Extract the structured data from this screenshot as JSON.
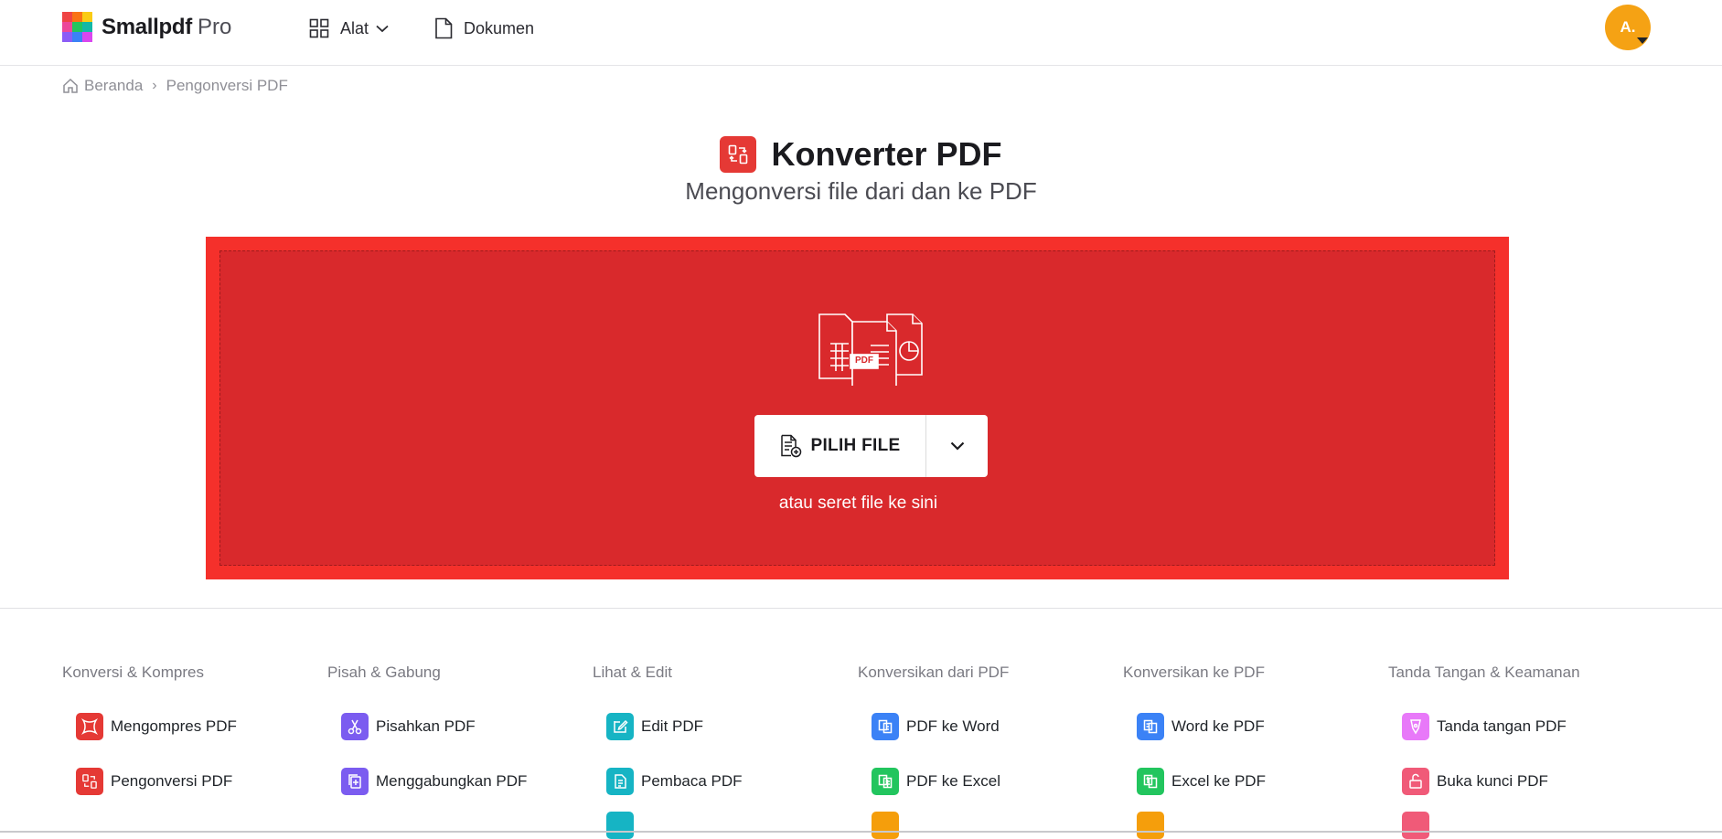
{
  "header": {
    "brand": "Smallpdf",
    "brand_suffix": "Pro",
    "nav_tools": "Alat",
    "nav_docs": "Dokumen",
    "avatar_initials": "A."
  },
  "breadcrumb": {
    "home": "Beranda",
    "separator": "›",
    "current": "Pengonversi PDF"
  },
  "hero": {
    "title": "Konverter PDF",
    "subtitle": "Mengonversi file dari dan ke PDF",
    "illustration_badge": "PDF",
    "choose_button": "PILIH FILE",
    "drop_hint": "atau seret file ke sini"
  },
  "colors": {
    "brand_red": "#e53935",
    "dropzone_outer": "#f5302b",
    "dropzone_inner": "#d9292c",
    "avatar": "#f5a214"
  },
  "tool_columns": [
    {
      "title": "Konversi & Kompres",
      "items": [
        {
          "label": "Mengompres PDF",
          "icon": "compress-icon",
          "color": "#e53935"
        },
        {
          "label": "Pengonversi PDF",
          "icon": "convert-icon",
          "color": "#e53935"
        }
      ],
      "stub_color": ""
    },
    {
      "title": "Pisah & Gabung",
      "items": [
        {
          "label": "Pisahkan PDF",
          "icon": "scissors-icon",
          "color": "#7b5cf0"
        },
        {
          "label": "Menggabungkan PDF",
          "icon": "merge-icon",
          "color": "#7b5cf0"
        }
      ],
      "stub_color": ""
    },
    {
      "title": "Lihat & Edit",
      "items": [
        {
          "label": "Edit PDF",
          "icon": "edit-icon",
          "color": "#16b4c4"
        },
        {
          "label": "Pembaca PDF",
          "icon": "reader-icon",
          "color": "#16b4c4"
        }
      ],
      "stub_color": "#16b4c4"
    },
    {
      "title": "Konversikan dari PDF",
      "items": [
        {
          "label": "PDF ke Word",
          "icon": "pdf-to-word-icon",
          "color": "#3b82f6"
        },
        {
          "label": "PDF ke Excel",
          "icon": "pdf-to-excel-icon",
          "color": "#22c55e"
        }
      ],
      "stub_color": "#f59e0b"
    },
    {
      "title": "Konversikan ke PDF",
      "items": [
        {
          "label": "Word ke PDF",
          "icon": "word-to-pdf-icon",
          "color": "#3b82f6"
        },
        {
          "label": "Excel ke PDF",
          "icon": "excel-to-pdf-icon",
          "color": "#22c55e"
        }
      ],
      "stub_color": "#f59e0b"
    },
    {
      "title": "Tanda Tangan & Keamanan",
      "items": [
        {
          "label": "Tanda tangan PDF",
          "icon": "sign-icon",
          "color": "#e879f9"
        },
        {
          "label": "Buka kunci PDF",
          "icon": "unlock-icon",
          "color": "#f05a78"
        }
      ],
      "stub_color": "#f05a78"
    }
  ]
}
